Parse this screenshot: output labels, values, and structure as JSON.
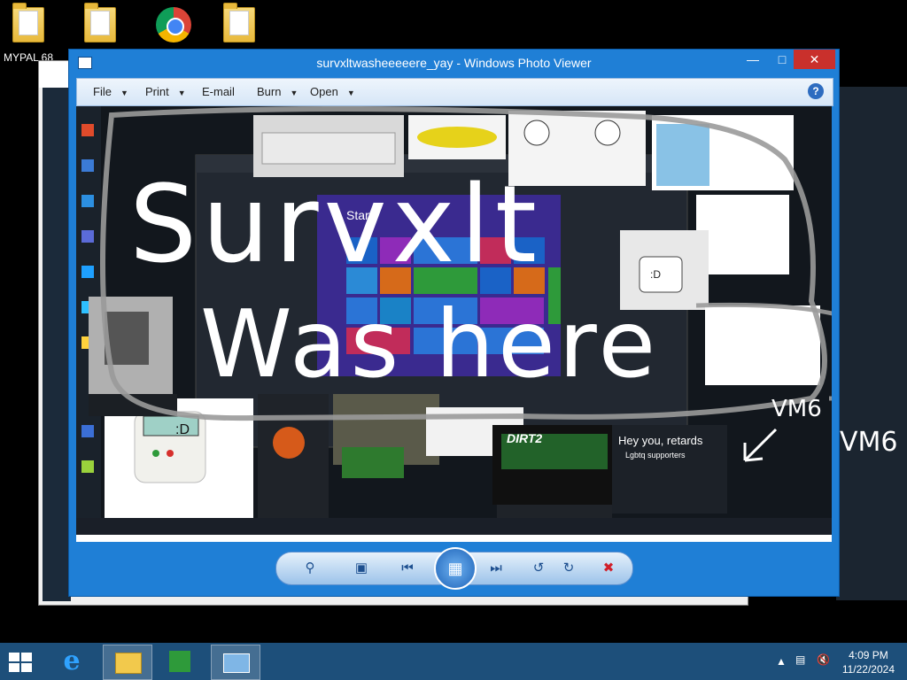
{
  "desktop": {
    "icons": [
      {
        "label": "MYPAL 68"
      },
      {
        "label": ""
      },
      {
        "label": ""
      },
      {
        "label": ""
      }
    ]
  },
  "viewer": {
    "title": "survxltwasheeeeere_yay - Windows Photo Viewer",
    "menu": {
      "file": "File",
      "print": "Print",
      "email": "E-mail",
      "burn": "Burn",
      "open": "Open"
    },
    "help": "?",
    "photo": {
      "scrawl_line1": "Survxlt",
      "scrawl_line2": "Was here",
      "vm6_a": "VM6",
      "vm6_b": "VM6",
      "start_label": "Start",
      "banner": "Hey you, retards",
      "sub_banner": "Lgbtq supporters",
      "dirt": "DIRT2",
      "robot_face": ":D"
    }
  },
  "taskbar": {
    "time": "4:09 PM",
    "date": "11/22/2024"
  },
  "colors": {
    "viewer_frame": "#1f7fd6",
    "taskbar": "#1d4f7a",
    "close_button": "#c9302c"
  }
}
